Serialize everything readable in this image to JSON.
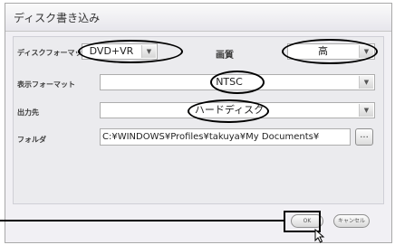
{
  "dialog": {
    "title": "ディスク書き込み"
  },
  "disc_format": {
    "label": "ディスクフォーマット",
    "value": "DVD+VR"
  },
  "quality": {
    "label": "画質",
    "value": "高"
  },
  "display_format": {
    "label": "表示フォーマット",
    "value": "NTSC"
  },
  "output": {
    "label": "出力先",
    "value": "ハードディスク"
  },
  "folder": {
    "label": "フォルダ",
    "value": "C:¥WINDOWS¥Profiles¥takuya¥My Documents¥",
    "browse_label": "..."
  },
  "buttons": {
    "ok": "OK",
    "cancel": "キャンセル"
  },
  "icons": {
    "dropdown": "chevron-down-icon",
    "cursor": "mouse-pointer-icon"
  }
}
